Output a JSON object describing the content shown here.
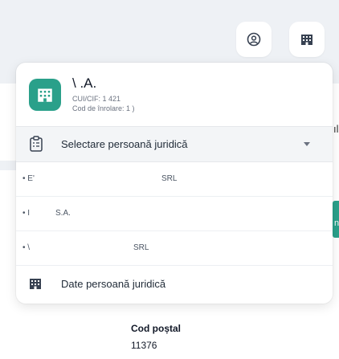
{
  "colors": {
    "accent": "#2aa08a",
    "band": "#eef1f5"
  },
  "topbar": {
    "buttons": [
      {
        "icon": "user-circle-icon"
      },
      {
        "icon": "building-icon"
      }
    ]
  },
  "company": {
    "name": "\\      .A.",
    "cui_line": "CUI/CIF: 1     421",
    "reg_line": "Cod de înrolare: 1       )"
  },
  "selector": {
    "label": "Selectare persoană juridică",
    "icon": "clipboard-list-icon"
  },
  "options": [
    {
      "prefix": "• E'",
      "suffix": "SRL"
    },
    {
      "prefix": "• I",
      "suffix": "S.A."
    },
    {
      "prefix": "• \\",
      "suffix": "SRL"
    }
  ],
  "footer": {
    "label": "Date persoană juridică",
    "icon": "building-icon"
  },
  "background": {
    "field_label": "Cod poștal",
    "field_value": "11376",
    "edge_char": "ıl",
    "edge_char2": "n"
  }
}
